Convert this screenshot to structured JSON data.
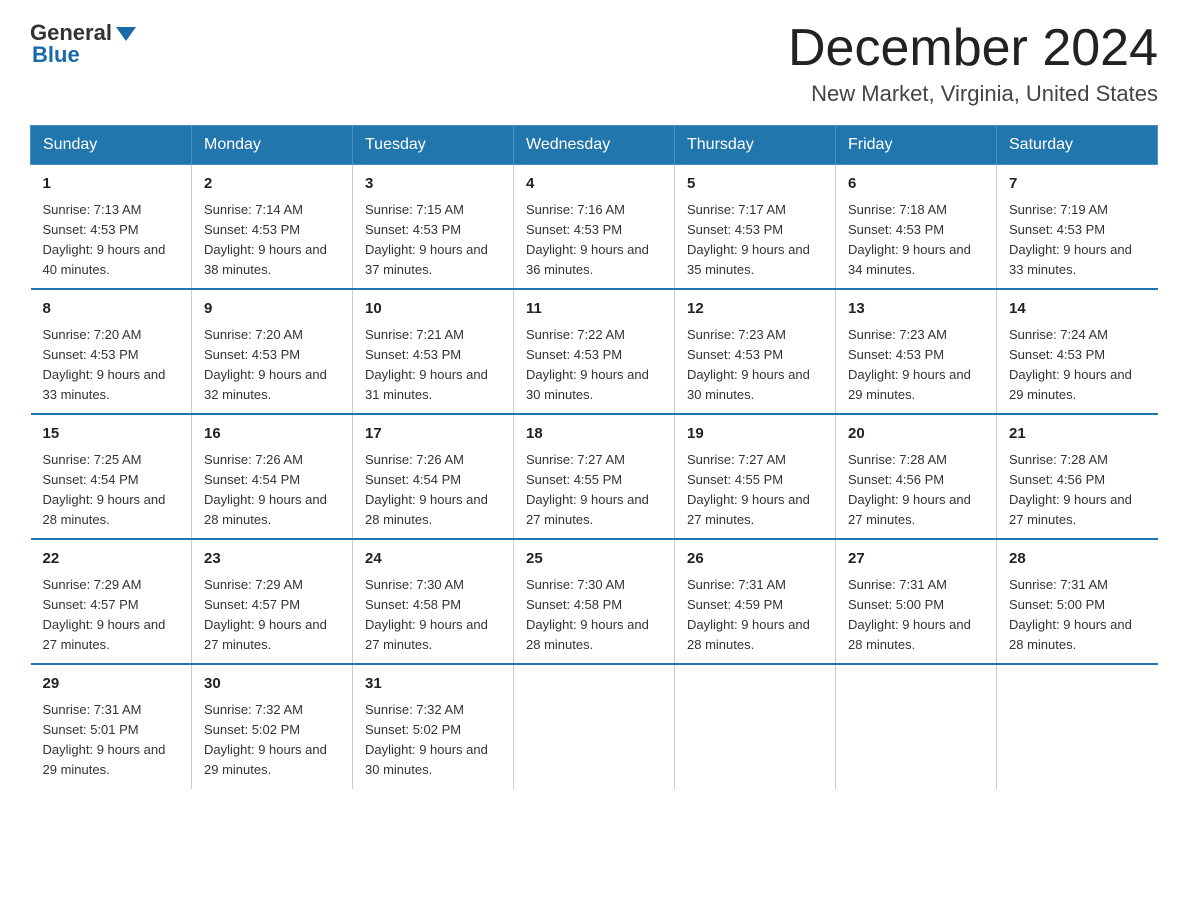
{
  "header": {
    "logo_general": "General",
    "logo_blue": "Blue",
    "month_title": "December 2024",
    "location": "New Market, Virginia, United States"
  },
  "days_of_week": [
    "Sunday",
    "Monday",
    "Tuesday",
    "Wednesday",
    "Thursday",
    "Friday",
    "Saturday"
  ],
  "weeks": [
    [
      {
        "day": "1",
        "sunrise": "7:13 AM",
        "sunset": "4:53 PM",
        "daylight": "9 hours and 40 minutes."
      },
      {
        "day": "2",
        "sunrise": "7:14 AM",
        "sunset": "4:53 PM",
        "daylight": "9 hours and 38 minutes."
      },
      {
        "day": "3",
        "sunrise": "7:15 AM",
        "sunset": "4:53 PM",
        "daylight": "9 hours and 37 minutes."
      },
      {
        "day": "4",
        "sunrise": "7:16 AM",
        "sunset": "4:53 PM",
        "daylight": "9 hours and 36 minutes."
      },
      {
        "day": "5",
        "sunrise": "7:17 AM",
        "sunset": "4:53 PM",
        "daylight": "9 hours and 35 minutes."
      },
      {
        "day": "6",
        "sunrise": "7:18 AM",
        "sunset": "4:53 PM",
        "daylight": "9 hours and 34 minutes."
      },
      {
        "day": "7",
        "sunrise": "7:19 AM",
        "sunset": "4:53 PM",
        "daylight": "9 hours and 33 minutes."
      }
    ],
    [
      {
        "day": "8",
        "sunrise": "7:20 AM",
        "sunset": "4:53 PM",
        "daylight": "9 hours and 33 minutes."
      },
      {
        "day": "9",
        "sunrise": "7:20 AM",
        "sunset": "4:53 PM",
        "daylight": "9 hours and 32 minutes."
      },
      {
        "day": "10",
        "sunrise": "7:21 AM",
        "sunset": "4:53 PM",
        "daylight": "9 hours and 31 minutes."
      },
      {
        "day": "11",
        "sunrise": "7:22 AM",
        "sunset": "4:53 PM",
        "daylight": "9 hours and 30 minutes."
      },
      {
        "day": "12",
        "sunrise": "7:23 AM",
        "sunset": "4:53 PM",
        "daylight": "9 hours and 30 minutes."
      },
      {
        "day": "13",
        "sunrise": "7:23 AM",
        "sunset": "4:53 PM",
        "daylight": "9 hours and 29 minutes."
      },
      {
        "day": "14",
        "sunrise": "7:24 AM",
        "sunset": "4:53 PM",
        "daylight": "9 hours and 29 minutes."
      }
    ],
    [
      {
        "day": "15",
        "sunrise": "7:25 AM",
        "sunset": "4:54 PM",
        "daylight": "9 hours and 28 minutes."
      },
      {
        "day": "16",
        "sunrise": "7:26 AM",
        "sunset": "4:54 PM",
        "daylight": "9 hours and 28 minutes."
      },
      {
        "day": "17",
        "sunrise": "7:26 AM",
        "sunset": "4:54 PM",
        "daylight": "9 hours and 28 minutes."
      },
      {
        "day": "18",
        "sunrise": "7:27 AM",
        "sunset": "4:55 PM",
        "daylight": "9 hours and 27 minutes."
      },
      {
        "day": "19",
        "sunrise": "7:27 AM",
        "sunset": "4:55 PM",
        "daylight": "9 hours and 27 minutes."
      },
      {
        "day": "20",
        "sunrise": "7:28 AM",
        "sunset": "4:56 PM",
        "daylight": "9 hours and 27 minutes."
      },
      {
        "day": "21",
        "sunrise": "7:28 AM",
        "sunset": "4:56 PM",
        "daylight": "9 hours and 27 minutes."
      }
    ],
    [
      {
        "day": "22",
        "sunrise": "7:29 AM",
        "sunset": "4:57 PM",
        "daylight": "9 hours and 27 minutes."
      },
      {
        "day": "23",
        "sunrise": "7:29 AM",
        "sunset": "4:57 PM",
        "daylight": "9 hours and 27 minutes."
      },
      {
        "day": "24",
        "sunrise": "7:30 AM",
        "sunset": "4:58 PM",
        "daylight": "9 hours and 27 minutes."
      },
      {
        "day": "25",
        "sunrise": "7:30 AM",
        "sunset": "4:58 PM",
        "daylight": "9 hours and 28 minutes."
      },
      {
        "day": "26",
        "sunrise": "7:31 AM",
        "sunset": "4:59 PM",
        "daylight": "9 hours and 28 minutes."
      },
      {
        "day": "27",
        "sunrise": "7:31 AM",
        "sunset": "5:00 PM",
        "daylight": "9 hours and 28 minutes."
      },
      {
        "day": "28",
        "sunrise": "7:31 AM",
        "sunset": "5:00 PM",
        "daylight": "9 hours and 28 minutes."
      }
    ],
    [
      {
        "day": "29",
        "sunrise": "7:31 AM",
        "sunset": "5:01 PM",
        "daylight": "9 hours and 29 minutes."
      },
      {
        "day": "30",
        "sunrise": "7:32 AM",
        "sunset": "5:02 PM",
        "daylight": "9 hours and 29 minutes."
      },
      {
        "day": "31",
        "sunrise": "7:32 AM",
        "sunset": "5:02 PM",
        "daylight": "9 hours and 30 minutes."
      },
      {
        "day": "",
        "sunrise": "",
        "sunset": "",
        "daylight": ""
      },
      {
        "day": "",
        "sunrise": "",
        "sunset": "",
        "daylight": ""
      },
      {
        "day": "",
        "sunrise": "",
        "sunset": "",
        "daylight": ""
      },
      {
        "day": "",
        "sunrise": "",
        "sunset": "",
        "daylight": ""
      }
    ]
  ],
  "labels": {
    "sunrise_prefix": "Sunrise: ",
    "sunset_prefix": "Sunset: ",
    "daylight_prefix": "Daylight: "
  }
}
